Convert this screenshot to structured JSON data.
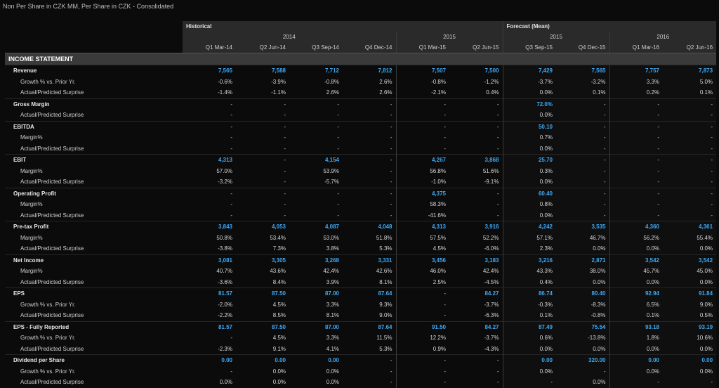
{
  "title": "Non Per Share in CZK MM, Per Share in CZK - Consolidated",
  "groups": {
    "historical": "Historical",
    "forecast": "Forecast (Mean)"
  },
  "years": {
    "h2014": "2014",
    "h2015": "2015",
    "f2015": "2015",
    "f2016": "2016"
  },
  "periods": [
    "Q1 Mar-14",
    "Q2 Jun-14",
    "Q3 Sep-14",
    "Q4 Dec-14",
    "Q1 Mar-15",
    "Q2 Jun-15",
    "Q3 Sep-15",
    "Q4 Dec-15",
    "Q1 Mar-16",
    "Q2 Jun-16"
  ],
  "section_title": "INCOME STATEMENT",
  "rows": [
    {
      "label": "Revenue",
      "type": "main",
      "values": [
        "7,565",
        "7,588",
        "7,712",
        "7,812",
        "7,507",
        "7,500",
        "7,429",
        "7,565",
        "7,757",
        "7,873"
      ]
    },
    {
      "label": "Growth % vs. Prior Yr.",
      "type": "sub",
      "values": [
        "-0.6%",
        "-3.9%",
        "-0.8%",
        "2.6%",
        "-0.8%",
        "-1.2%",
        "-3.7%",
        "-3.2%",
        "3.3%",
        "5.0%"
      ]
    },
    {
      "label": "Actual/Predicted Surprise",
      "type": "sub",
      "values": [
        "-1.4%",
        "-1.1%",
        "2.6%",
        "2.6%",
        "-2.1%",
        "0.4%",
        "0.0%",
        "0.1%",
        "0.2%",
        "0.1%"
      ]
    },
    {
      "label": "Gross Margin",
      "type": "main",
      "values": [
        "-",
        "-",
        "-",
        "-",
        "-",
        "-",
        "72.0%",
        "-",
        "-",
        "-"
      ]
    },
    {
      "label": "Actual/Predicted Surprise",
      "type": "sub",
      "values": [
        "-",
        "-",
        "-",
        "-",
        "-",
        "-",
        "0.0%",
        "-",
        "-",
        "-"
      ]
    },
    {
      "label": "EBITDA",
      "type": "main",
      "values": [
        "-",
        "-",
        "-",
        "-",
        "-",
        "-",
        "50.10",
        "-",
        "-",
        "-"
      ]
    },
    {
      "label": "Margin%",
      "type": "sub",
      "values": [
        "-",
        "-",
        "-",
        "-",
        "-",
        "-",
        "0.7%",
        "-",
        "-",
        "-"
      ]
    },
    {
      "label": "Actual/Predicted Surprise",
      "type": "sub",
      "values": [
        "-",
        "-",
        "-",
        "-",
        "-",
        "-",
        "0.0%",
        "-",
        "-",
        "-"
      ]
    },
    {
      "label": "EBIT",
      "type": "main",
      "values": [
        "4,313",
        "-",
        "4,154",
        "-",
        "4,267",
        "3,868",
        "25.70",
        "-",
        "-",
        "-"
      ]
    },
    {
      "label": "Margin%",
      "type": "sub",
      "values": [
        "57.0%",
        "-",
        "53.9%",
        "-",
        "56.8%",
        "51.6%",
        "0.3%",
        "-",
        "-",
        "-"
      ]
    },
    {
      "label": "Actual/Predicted Surprise",
      "type": "sub",
      "values": [
        "-3.2%",
        "-",
        "-5.7%",
        "-",
        "-1.0%",
        "-9.1%",
        "0.0%",
        "-",
        "-",
        "-"
      ]
    },
    {
      "label": "Operating Profit",
      "type": "main",
      "values": [
        "-",
        "-",
        "-",
        "-",
        "4,375",
        "-",
        "60.40",
        "-",
        "-",
        "-"
      ]
    },
    {
      "label": "Margin%",
      "type": "sub",
      "values": [
        "-",
        "-",
        "-",
        "-",
        "58.3%",
        "-",
        "0.8%",
        "-",
        "-",
        "-"
      ]
    },
    {
      "label": "Actual/Predicted Surprise",
      "type": "sub",
      "values": [
        "-",
        "-",
        "-",
        "-",
        "-41.6%",
        "-",
        "0.0%",
        "-",
        "-",
        "-"
      ]
    },
    {
      "label": "Pre-tax Profit",
      "type": "main",
      "values": [
        "3,843",
        "4,053",
        "4,087",
        "4,048",
        "4,313",
        "3,916",
        "4,242",
        "3,535",
        "4,360",
        "4,361"
      ]
    },
    {
      "label": "Margin%",
      "type": "sub",
      "values": [
        "50.8%",
        "53.4%",
        "53.0%",
        "51.8%",
        "57.5%",
        "52.2%",
        "57.1%",
        "46.7%",
        "56.2%",
        "55.4%"
      ]
    },
    {
      "label": "Actual/Predicted Surprise",
      "type": "sub",
      "values": [
        "-3.8%",
        "7.3%",
        "3.8%",
        "5.3%",
        "4.5%",
        "-6.0%",
        "2.3%",
        "0.0%",
        "0.0%",
        "0.0%"
      ]
    },
    {
      "label": "Net Income",
      "type": "main",
      "values": [
        "3,081",
        "3,305",
        "3,268",
        "3,331",
        "3,456",
        "3,183",
        "3,216",
        "2,871",
        "3,542",
        "3,542"
      ]
    },
    {
      "label": "Margin%",
      "type": "sub",
      "values": [
        "40.7%",
        "43.6%",
        "42.4%",
        "42.6%",
        "46.0%",
        "42.4%",
        "43.3%",
        "38.0%",
        "45.7%",
        "45.0%"
      ]
    },
    {
      "label": "Actual/Predicted Surprise",
      "type": "sub",
      "values": [
        "-3.6%",
        "8.4%",
        "3.9%",
        "8.1%",
        "2.5%",
        "-4.5%",
        "0.4%",
        "0.0%",
        "0.0%",
        "0.0%"
      ]
    },
    {
      "label": "EPS",
      "type": "main",
      "values": [
        "81.57",
        "87.50",
        "87.00",
        "87.64",
        "-",
        "84.27",
        "86.74",
        "80.40",
        "92.94",
        "91.84"
      ]
    },
    {
      "label": "Growth % vs. Prior Yr.",
      "type": "sub",
      "values": [
        "-2.0%",
        "4.5%",
        "3.3%",
        "9.3%",
        "-",
        "-3.7%",
        "-0.3%",
        "-8.3%",
        "6.5%",
        "9.0%"
      ]
    },
    {
      "label": "Actual/Predicted Surprise",
      "type": "sub",
      "values": [
        "-2.2%",
        "8.5%",
        "8.1%",
        "9.0%",
        "-",
        "-6.3%",
        "0.1%",
        "-0.8%",
        "0.1%",
        "0.5%"
      ]
    },
    {
      "label": "EPS - Fully Reported",
      "type": "main",
      "values": [
        "81.57",
        "87.50",
        "87.00",
        "87.64",
        "91.50",
        "84.27",
        "87.49",
        "75.54",
        "93.18",
        "93.19"
      ]
    },
    {
      "label": "Growth % vs. Prior Yr.",
      "type": "sub",
      "values": [
        "-",
        "4.5%",
        "3.3%",
        "11.5%",
        "12.2%",
        "-3.7%",
        "0.6%",
        "-13.8%",
        "1.8%",
        "10.6%"
      ]
    },
    {
      "label": "Actual/Predicted Surprise",
      "type": "sub",
      "values": [
        "-2.3%",
        "9.1%",
        "4.1%",
        "5.3%",
        "0.9%",
        "-4.3%",
        "0.0%",
        "0.0%",
        "0.0%",
        "0.0%"
      ]
    },
    {
      "label": "Dividend per Share",
      "type": "main",
      "values": [
        "0.00",
        "0.00",
        "0.00",
        "-",
        "-",
        "-",
        "0.00",
        "320.00",
        "0.00",
        "0.00"
      ]
    },
    {
      "label": "Growth % vs. Prior Yr.",
      "type": "sub",
      "values": [
        "-",
        "0.0%",
        "0.0%",
        "-",
        "-",
        "-",
        "0.0%",
        "-",
        "0.0%",
        "0.0%"
      ]
    },
    {
      "label": "Actual/Predicted Surprise",
      "type": "sub",
      "values": [
        "0.0%",
        "0.0%",
        "0.0%",
        "-",
        "-",
        "-",
        "-",
        "0.0%",
        "-",
        "-"
      ]
    }
  ]
}
